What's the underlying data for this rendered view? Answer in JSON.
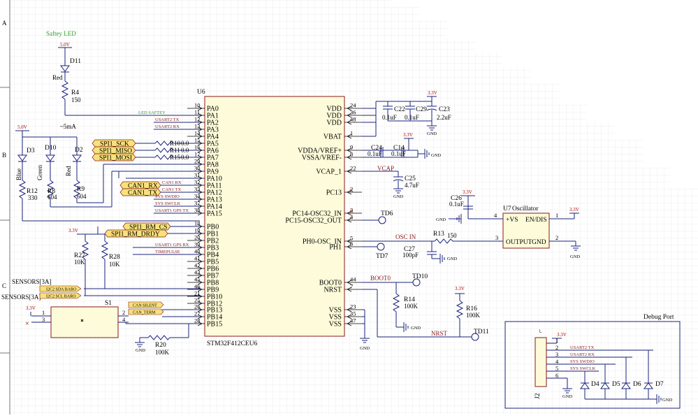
{
  "border": {
    "rows": [
      "A",
      "B",
      "C"
    ]
  },
  "labels": {
    "safety_led": "Saftey LED",
    "current": "~5mA",
    "debug_port": "Debug Port",
    "sensors": "SENSORS[3A]",
    "sensors2": "SENSORS[3A]"
  },
  "colors": {
    "wire": "#1a237e",
    "net": "#8b1a1a",
    "power": "#b00000",
    "ic_fill": "#fdfbd9",
    "flag_fill": "#f7e27a",
    "green": "#2e9e2e"
  },
  "power": {
    "v50": "5.0V",
    "v33": "3.3V",
    "gnd": "GND"
  },
  "u6": {
    "ref": "U6",
    "part": "STM32F412CEU6",
    "left_pins": [
      {
        "name": "PA0",
        "num": "10"
      },
      {
        "name": "PA1",
        "num": "11"
      },
      {
        "name": "PA2",
        "num": "12"
      },
      {
        "name": "PA3",
        "num": "13"
      },
      {
        "name": "PA4",
        "num": "14"
      },
      {
        "name": "PA5",
        "num": "15"
      },
      {
        "name": "PA6",
        "num": "16"
      },
      {
        "name": "PA7",
        "num": "17"
      },
      {
        "name": "PA8",
        "num": "29"
      },
      {
        "name": "PA9",
        "num": "30"
      },
      {
        "name": "PA10",
        "num": "31"
      },
      {
        "name": "PA11",
        "num": "32"
      },
      {
        "name": "PA12",
        "num": "33"
      },
      {
        "name": "PA13",
        "num": "34"
      },
      {
        "name": "PA14",
        "num": "37"
      },
      {
        "name": "PA15",
        "num": "38"
      },
      {
        "name": "PB0",
        "num": "18"
      },
      {
        "name": "PB1",
        "num": "19"
      },
      {
        "name": "PB2",
        "num": "20"
      },
      {
        "name": "PB3",
        "num": "39"
      },
      {
        "name": "PB4",
        "num": "40"
      },
      {
        "name": "PB5",
        "num": "41"
      },
      {
        "name": "PB6",
        "num": "42"
      },
      {
        "name": "PB7",
        "num": "43"
      },
      {
        "name": "PB8",
        "num": "45"
      },
      {
        "name": "PB9",
        "num": "46"
      },
      {
        "name": "PB10",
        "num": "21"
      },
      {
        "name": "PB12",
        "num": "25"
      },
      {
        "name": "PB13",
        "num": "26"
      },
      {
        "name": "PB14",
        "num": "27"
      },
      {
        "name": "PB15",
        "num": "28"
      }
    ],
    "right_pins": [
      {
        "name": "VDD",
        "num": "24"
      },
      {
        "name": "VDD",
        "num": "36"
      },
      {
        "name": "VDD",
        "num": "48"
      },
      {
        "name": "VBAT",
        "num": "1"
      },
      {
        "name": "VDDA/VREF+",
        "num": "9"
      },
      {
        "name": "VSSA/VREF-",
        "num": "8"
      },
      {
        "name": "VCAP_1",
        "num": "22"
      },
      {
        "name": "PC13",
        "num": "2"
      },
      {
        "name": "PC14-OSC32_IN",
        "num": "3"
      },
      {
        "name": "PC15-OSC32_OUT",
        "num": "4"
      },
      {
        "name": "PH0-OSC_IN",
        "num": "5"
      },
      {
        "name": "PH1",
        "num": "6"
      },
      {
        "name": "BOOT0",
        "num": "44"
      },
      {
        "name": "NRST",
        "num": "7"
      },
      {
        "name": "VSS",
        "num": "23"
      },
      {
        "name": "VSS",
        "num": "35"
      },
      {
        "name": "VSS",
        "num": "47"
      }
    ]
  },
  "nets": {
    "led_safety": "LED SAFTEY",
    "usart2_tx": "USART2 TX",
    "usart2_rx": "USART2 RX",
    "can1_rx": "CAN1 RX",
    "can1_tx": "CAN1 TX",
    "sys_swdio": "SYS SWDIO",
    "sys_swclk": "SYS SWCLK",
    "usart1_gps_tx": "USART1 GPS TX",
    "usart1_gps_rx": "USART1 GPS RX",
    "timepulse": "TIMEPULSE",
    "i2c2_sda": "I2C2 SDA BARO",
    "i2c2_scl": "I2C2 SCL BARO",
    "can_silent": "CAN SILENT",
    "can_term": "CAN_TERM",
    "vcap": "VCAP",
    "osc_in": "OSC IN",
    "boot0": "BOOT0",
    "nrst": "NRST"
  },
  "flags": {
    "spi1_sck": "SPI1_SCK",
    "spi1_miso": "SPI1_MISO",
    "spi1_mosi": "SPI1_MOSI",
    "can1_rx": "CAN1_RX",
    "can1_tx": "CAN1_TX",
    "spi1_rm_cs": "SPI1_RM_CS",
    "spi1_rm_drdy": "SPI1_RM_DRDY"
  },
  "components": {
    "d11": {
      "ref": "D11",
      "value": "Red"
    },
    "r4": {
      "ref": "R4",
      "value": "150"
    },
    "d3": {
      "ref": "D3",
      "value": "Blue"
    },
    "d10": {
      "ref": "D10",
      "value": "Green"
    },
    "d2": {
      "ref": "D2",
      "value": "Red"
    },
    "r12": {
      "ref": "R12",
      "value": "330"
    },
    "r8": {
      "ref": "R8",
      "value": "604"
    },
    "r9": {
      "ref": "R9",
      "value": "604"
    },
    "r10": {
      "ref": "R10",
      "value": "0.0"
    },
    "r11": {
      "ref": "R11",
      "value": "0.0"
    },
    "r15": {
      "ref": "R15",
      "value": "0.0"
    },
    "r27": {
      "ref": "R27",
      "value": "10K"
    },
    "r28": {
      "ref": "R28",
      "value": "10K"
    },
    "s1": {
      "ref": "S1"
    },
    "r20": {
      "ref": "R20",
      "value": "100K"
    },
    "c22": {
      "ref": "C22",
      "value": "0.1uF"
    },
    "c29": {
      "ref": "C29",
      "value": "0.1uF"
    },
    "c23": {
      "ref": "C23",
      "value": "2.2uF"
    },
    "c24": {
      "ref": "C24",
      "value": "0.1uF"
    },
    "c14": {
      "ref": "C14",
      "value": "0.1uF"
    },
    "c25": {
      "ref": "C25",
      "value": "4.7uF"
    },
    "c26": {
      "ref": "C26",
      "value": "0.1uF"
    },
    "c27": {
      "ref": "C27",
      "value": "100pF"
    },
    "r13": {
      "ref": "R13",
      "value": "150"
    },
    "r14": {
      "ref": "R14",
      "value": "100K"
    },
    "r16": {
      "ref": "R16",
      "value": "100K"
    },
    "u7": {
      "ref": "U7",
      "value": "Oscillator",
      "pin_vs": "+VS",
      "pin_en": "EN/DIS",
      "pin_out": "OUTPUT",
      "pin_gnd": "GND"
    },
    "j2": {
      "ref": "J2"
    },
    "d4": {
      "ref": "D4"
    },
    "d5": {
      "ref": "D5"
    },
    "d6": {
      "ref": "D6"
    },
    "d7": {
      "ref": "D7"
    },
    "td6": {
      "ref": "TD6"
    },
    "td7": {
      "ref": "TD7"
    },
    "td10": {
      "ref": "TD10"
    },
    "td11": {
      "ref": "TD11"
    }
  },
  "debug": {
    "pins": [
      "1",
      "2",
      "3",
      "4",
      "5",
      "6"
    ],
    "nets": [
      "3.3V",
      "USART2 TX",
      "USART2 RX",
      "SYS SWDIO",
      "SYS SWCLK"
    ]
  },
  "s1_pins": [
    "1",
    "2",
    "3",
    "4"
  ],
  "u7_pins": [
    "4",
    "1",
    "3",
    "2"
  ]
}
